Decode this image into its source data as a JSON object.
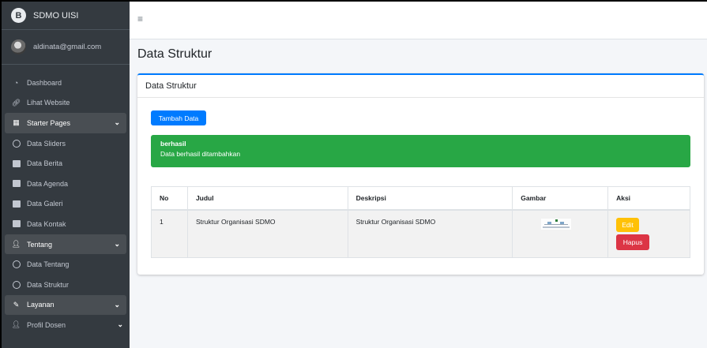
{
  "brand": {
    "name": "SDMO UISI",
    "logo_letter": "B"
  },
  "user": {
    "email": "aldinata@gmail.com"
  },
  "sidebar": {
    "items": [
      {
        "label": "Dashboard",
        "icon": "dashboard-icon"
      },
      {
        "label": "Lihat Website",
        "icon": "link-icon"
      },
      {
        "label": "Starter Pages",
        "icon": "grid-icon",
        "expanded": true
      },
      {
        "label": "Data Sliders",
        "icon": "circle-icon"
      },
      {
        "label": "Data Berita",
        "icon": "image-icon"
      },
      {
        "label": "Data Agenda",
        "icon": "calendar-icon"
      },
      {
        "label": "Data Galeri",
        "icon": "gallery-icon"
      },
      {
        "label": "Data Kontak",
        "icon": "contact-icon"
      },
      {
        "label": "Tentang",
        "icon": "user-icon",
        "expanded": true
      },
      {
        "label": "Data Tentang",
        "icon": "circle-icon"
      },
      {
        "label": "Data Struktur",
        "icon": "circle-icon"
      },
      {
        "label": "Layanan",
        "icon": "edit-icon",
        "expanded": true
      },
      {
        "label": "Profil Dosen",
        "icon": "user-icon",
        "expanded": false
      }
    ]
  },
  "page": {
    "title": "Data Struktur",
    "card_title": "Data Struktur",
    "add_button": "Tambah Data"
  },
  "alert": {
    "title": "berhasil",
    "message": "Data berhasil ditambahkan",
    "color": "#28a745"
  },
  "table": {
    "headers": [
      "No",
      "Judul",
      "Deskripsi",
      "Gambar",
      "Aksi"
    ],
    "rows": [
      {
        "no": "1",
        "judul": "Struktur Organisasi SDMO",
        "deskripsi": "Struktur Organisasi SDMO",
        "edit": "Edit",
        "hapus": "Hapus"
      }
    ]
  },
  "colors": {
    "primary": "#007bff",
    "warning": "#ffc107",
    "danger": "#dc3545",
    "sidebar": "#343a40"
  }
}
